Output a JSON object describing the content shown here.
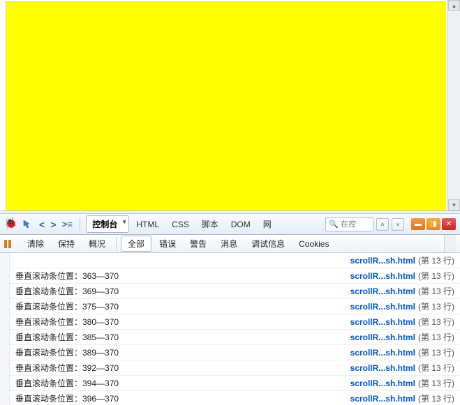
{
  "mainToolbar": {
    "panelTabs": [
      {
        "label": "控制台",
        "active": true
      },
      {
        "label": "HTML",
        "active": false
      },
      {
        "label": "CSS",
        "active": false
      },
      {
        "label": "脚本",
        "active": false
      },
      {
        "label": "DOM",
        "active": false
      },
      {
        "label": "网",
        "active": false
      }
    ],
    "searchPlaceholder": "在控"
  },
  "subToolbar": {
    "items": [
      {
        "label": "清除",
        "active": false
      },
      {
        "label": "保持",
        "active": false
      },
      {
        "label": "概况",
        "active": false
      },
      {
        "label": "全部",
        "active": true
      },
      {
        "label": "错误",
        "active": false
      },
      {
        "label": "警告",
        "active": false
      },
      {
        "label": "消息",
        "active": false
      },
      {
        "label": "调试信息",
        "active": false
      },
      {
        "label": "Cookies",
        "active": false
      }
    ]
  },
  "log": {
    "truncatedSrc": "scrollR...sh.html",
    "truncatedLine": "(第 13 行)",
    "rows": [
      {
        "msg": "垂直滚动条位置：363—370",
        "src": "scrollR...sh.html",
        "line": "(第 13 行)"
      },
      {
        "msg": "垂直滚动条位置：369—370",
        "src": "scrollR...sh.html",
        "line": "(第 13 行)"
      },
      {
        "msg": "垂直滚动条位置：375—370",
        "src": "scrollR...sh.html",
        "line": "(第 13 行)"
      },
      {
        "msg": "垂直滚动条位置：380—370",
        "src": "scrollR...sh.html",
        "line": "(第 13 行)"
      },
      {
        "msg": "垂直滚动条位置：385—370",
        "src": "scrollR...sh.html",
        "line": "(第 13 行)"
      },
      {
        "msg": "垂直滚动条位置：389—370",
        "src": "scrollR...sh.html",
        "line": "(第 13 行)"
      },
      {
        "msg": "垂直滚动条位置：392—370",
        "src": "scrollR...sh.html",
        "line": "(第 13 行)"
      },
      {
        "msg": "垂直滚动条位置：394—370",
        "src": "scrollR...sh.html",
        "line": "(第 13 行)"
      },
      {
        "msg": "垂直滚动条位置：396—370",
        "src": "scrollR...sh.html",
        "line": "(第 13 行)"
      }
    ]
  }
}
